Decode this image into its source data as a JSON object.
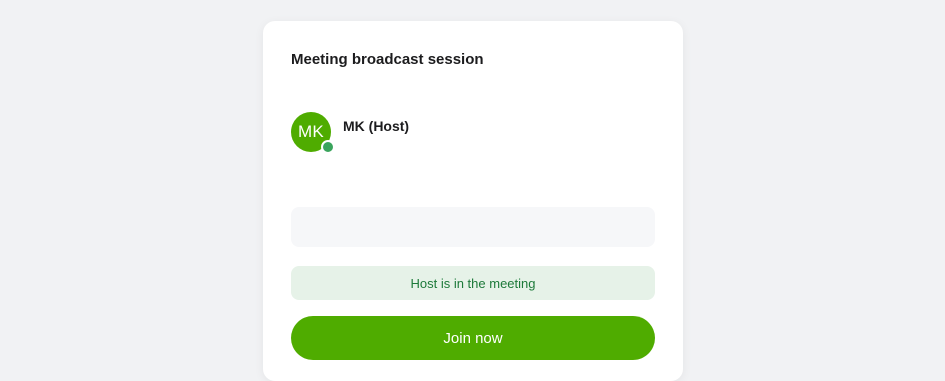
{
  "session": {
    "title": "Meeting broadcast session"
  },
  "participants": [
    {
      "initials": "MK",
      "name": "MK (Host)",
      "presence": "online",
      "avatar_color": "#4fac00",
      "presence_color": "#3aa45c"
    }
  ],
  "status": {
    "text": "Host is in the meeting",
    "color": "#1d7a3a",
    "background": "#e6f2e8"
  },
  "actions": {
    "join_label": "Join now",
    "accent": "#4fac00"
  }
}
